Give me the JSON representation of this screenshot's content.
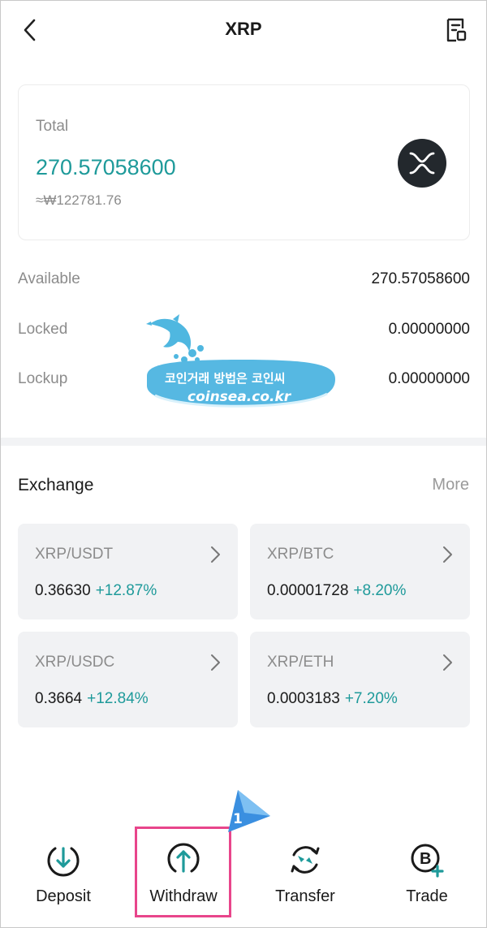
{
  "header": {
    "title": "XRP",
    "back_icon": "chevron-left-icon",
    "history_icon": "history-document-icon"
  },
  "total": {
    "label": "Total",
    "amount": "270.57058600",
    "fiat": "≈₩122781.76",
    "logo_icon": "xrp-logo-icon"
  },
  "balances": [
    {
      "label": "Available",
      "value": "270.57058600"
    },
    {
      "label": "Locked",
      "value": "0.00000000"
    },
    {
      "label": "Lockup",
      "value": "0.00000000"
    }
  ],
  "watermark": {
    "line1": "코인거래 방법은 코인씨",
    "line2": "coinsea.co.kr"
  },
  "exchange": {
    "title": "Exchange",
    "more": "More",
    "pairs": [
      {
        "name": "XRP/USDT",
        "price": "0.36630",
        "change": "+12.87%"
      },
      {
        "name": "XRP/BTC",
        "price": "0.00001728",
        "change": "+8.20%"
      },
      {
        "name": "XRP/USDC",
        "price": "0.3664",
        "change": "+12.84%"
      },
      {
        "name": "XRP/ETH",
        "price": "0.0003183",
        "change": "+7.20%"
      }
    ]
  },
  "actions": [
    {
      "label": "Deposit",
      "icon": "deposit-arrow-down-icon"
    },
    {
      "label": "Withdraw",
      "icon": "withdraw-arrow-up-icon"
    },
    {
      "label": "Transfer",
      "icon": "transfer-arrows-icon"
    },
    {
      "label": "Trade",
      "icon": "trade-b-plus-icon"
    }
  ],
  "annotation": {
    "step": "1"
  },
  "colors": {
    "accent": "#1e9a9a",
    "highlight": "#e8458b",
    "badge": "#3a8fe0"
  }
}
